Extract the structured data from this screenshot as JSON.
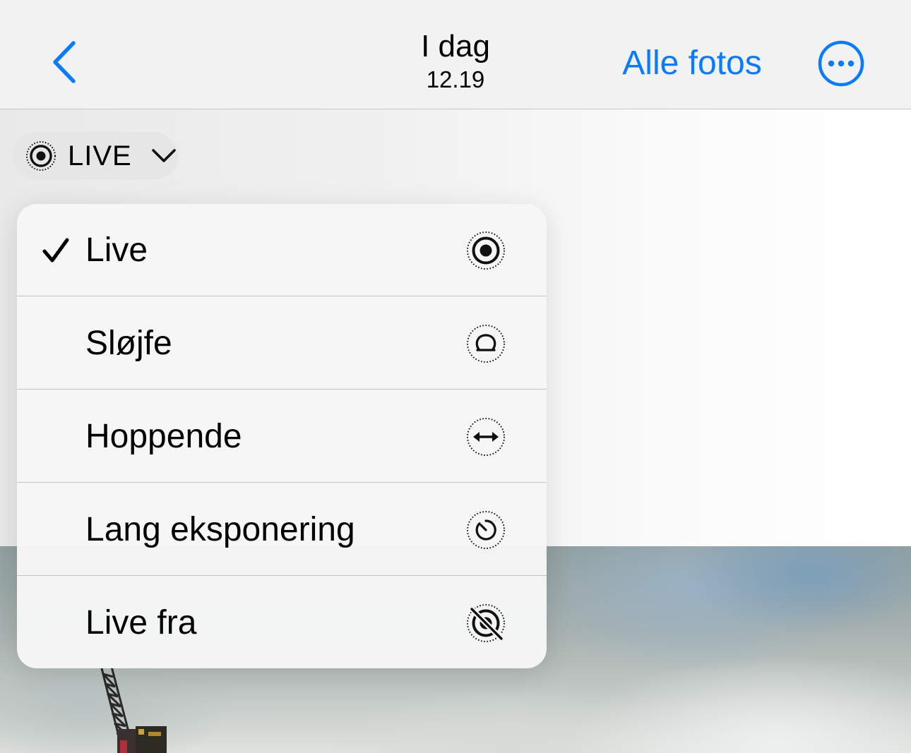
{
  "nav": {
    "back_icon": "chevron-left-icon",
    "title": "I dag",
    "subtitle": "12.19",
    "all_photos_label": "Alle fotos",
    "more_icon": "ellipsis-circle-icon"
  },
  "live_pill": {
    "icon": "live-photo-icon",
    "label": "LIVE",
    "chevron_icon": "chevron-down-icon"
  },
  "menu": {
    "items": [
      {
        "label": "Live",
        "icon": "live-photo-icon",
        "selected": true
      },
      {
        "label": "Sløjfe",
        "icon": "loop-icon",
        "selected": false
      },
      {
        "label": "Hoppende",
        "icon": "bounce-icon",
        "selected": false
      },
      {
        "label": "Lang eksponering",
        "icon": "long-exposure-icon",
        "selected": false
      },
      {
        "label": "Live fra",
        "icon": "live-off-icon",
        "selected": false
      }
    ]
  },
  "colors": {
    "accent": "#0a7aff",
    "navbar_bg": "#f2f2f2",
    "menu_bg": "#f6f6f6",
    "divider": "#c4c4c6"
  }
}
